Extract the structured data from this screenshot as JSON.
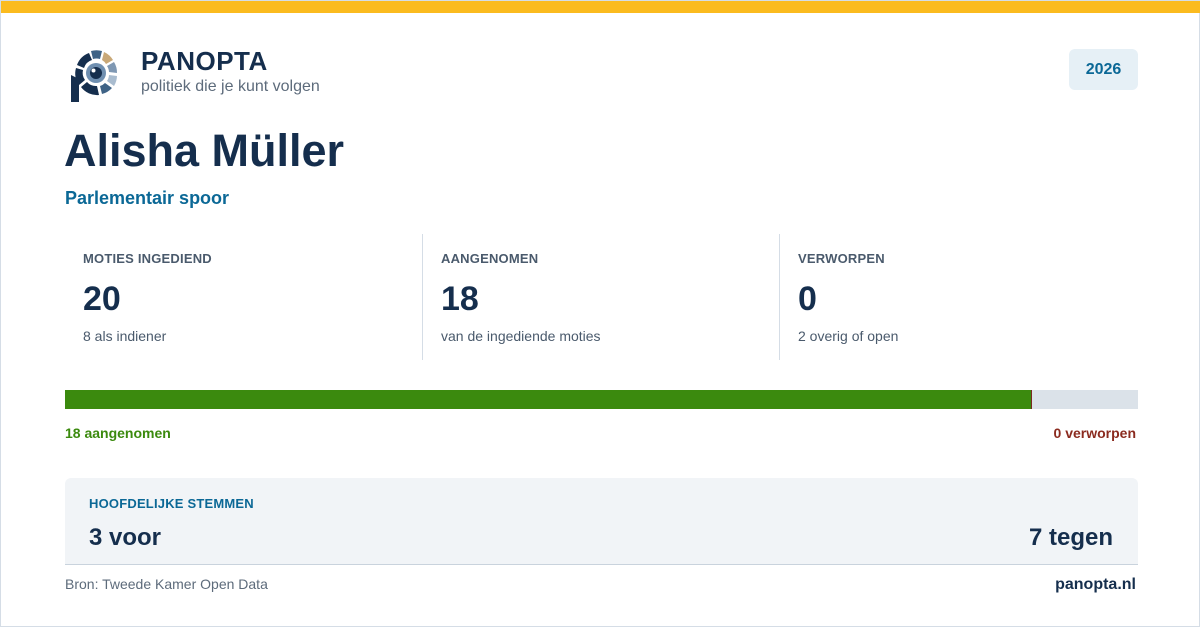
{
  "brand": {
    "name": "PANOPTA",
    "tagline": "politiek die je kunt volgen",
    "logo_icon": "panopta-eye-logo"
  },
  "year_badge": "2026",
  "person": {
    "name": "Alisha Müller",
    "track": "Parlementair spoor"
  },
  "stats": [
    {
      "label": "MOTIES INGEDIEND",
      "value": "20",
      "sub": "8 als indiener"
    },
    {
      "label": "AANGENOMEN",
      "value": "18",
      "sub": "van de ingediende moties"
    },
    {
      "label": "VERWORPEN",
      "value": "0",
      "sub": "2 overig of open"
    }
  ],
  "progress": {
    "accepted_fraction": 0.9,
    "rejected_fraction": 0.0,
    "accepted_label": "18 aangenomen",
    "rejected_label": "0 verworpen"
  },
  "votes": {
    "label": "HOOFDELIJKE STEMMEN",
    "for": "3 voor",
    "against": "7 tegen"
  },
  "footer": {
    "source": "Bron: Tweede Kamer Open Data",
    "site": "panopta.nl"
  },
  "colors": {
    "accent_top": "#fbbb1f",
    "navy": "#152e4d",
    "blue": "#0b6896",
    "green": "#3b8a0e",
    "red": "#8b2b1f"
  }
}
